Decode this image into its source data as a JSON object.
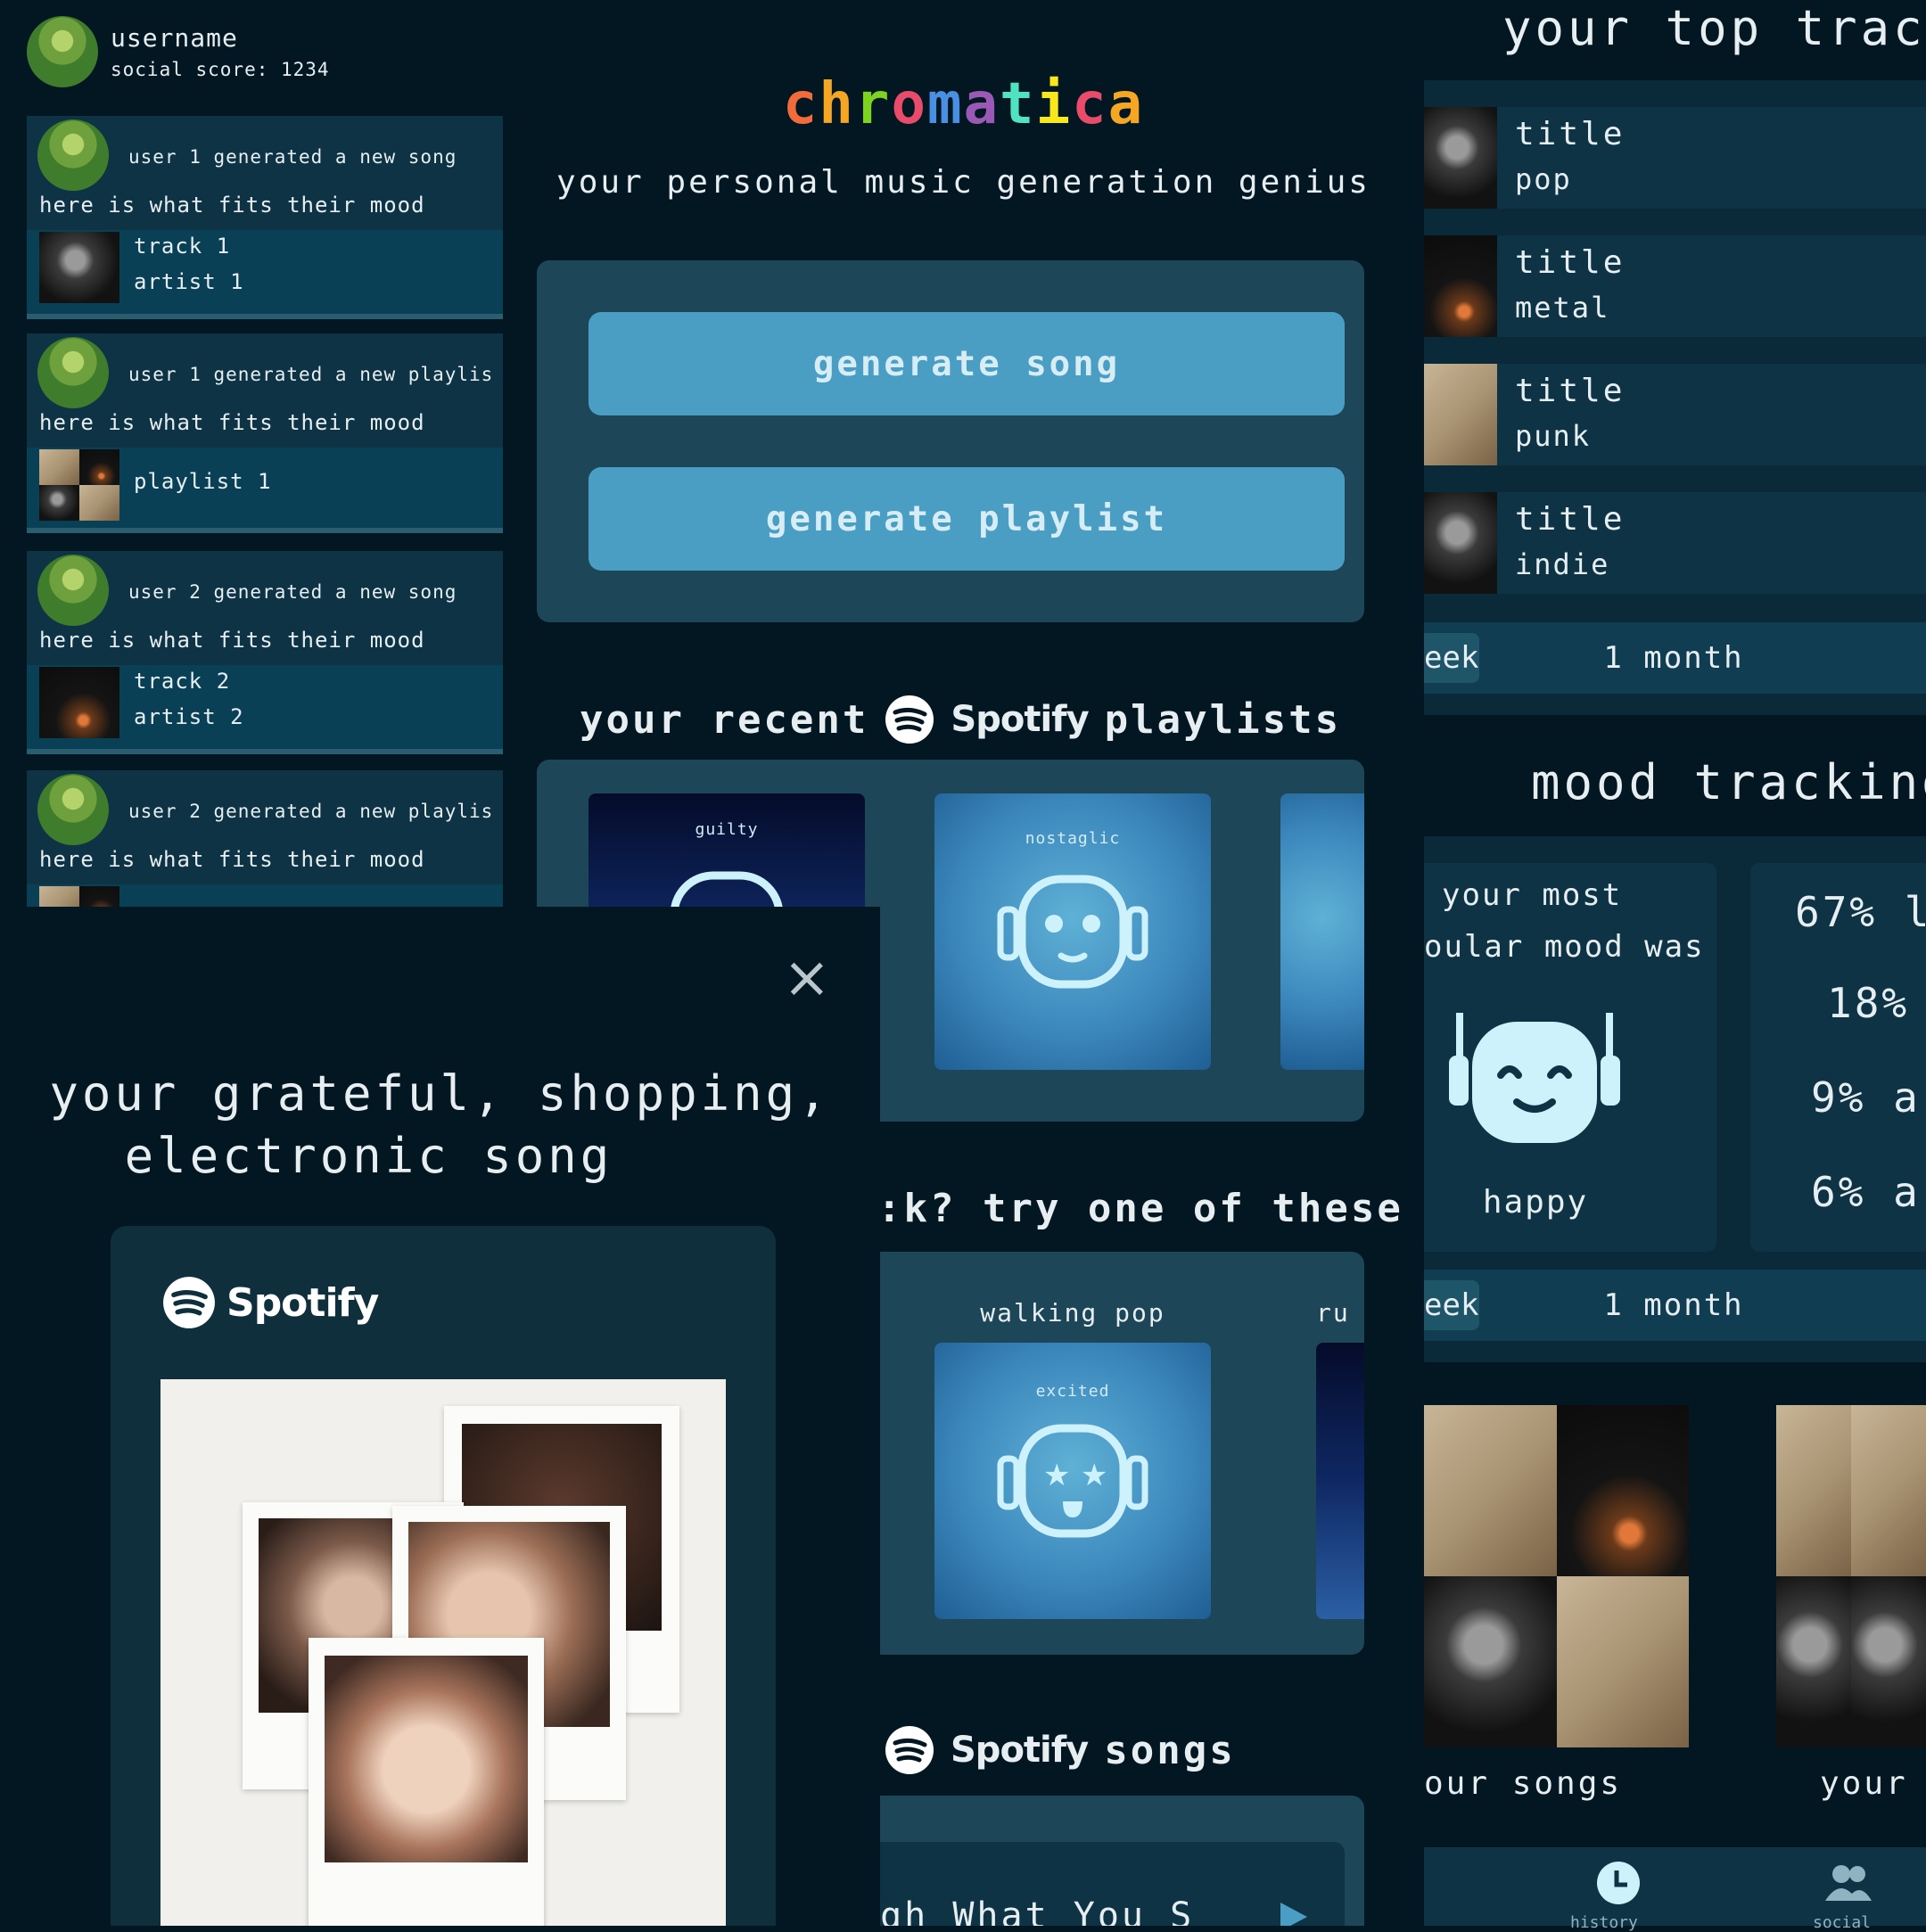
{
  "profile": {
    "username": "username",
    "social_score": "social score: 1234"
  },
  "feed": [
    {
      "headline": "user 1 generated a new song",
      "subline": "here is what fits their mood",
      "line1": "track 1",
      "line2": "artist 1"
    },
    {
      "headline": "user 1 generated a new playlis",
      "subline": "here is what fits their mood",
      "line1": "playlist 1",
      "line2": ""
    },
    {
      "headline": "user 2 generated a new song",
      "subline": "here is what fits their mood",
      "line1": "track 2",
      "line2": "artist 2"
    },
    {
      "headline": "user 2 generated a new playlis",
      "subline": "here is what fits their mood",
      "line1": "",
      "line2": ""
    }
  ],
  "home": {
    "logo": "chromatica",
    "tagline": "your personal music generation genius",
    "generate_song": "generate song",
    "generate_playlist": "generate playlist",
    "recent_prefix": "your recent",
    "recent_suffix": "playlists",
    "spotify_word": "Spotify",
    "recent_tiles": [
      "guilty",
      "nostaglic",
      ""
    ],
    "try_heading": ":k? try one of these",
    "try_labels": [
      "walking pop",
      "ru"
    ],
    "try_tiles": [
      "excited",
      ""
    ],
    "songs_suffix": "songs",
    "partial_song": "igh What You S"
  },
  "stats": {
    "top_tracks_title": "your top track",
    "top_tracks": [
      {
        "title": "title",
        "genre": "pop"
      },
      {
        "title": "title",
        "genre": "metal"
      },
      {
        "title": "title",
        "genre": "punk"
      },
      {
        "title": "title",
        "genre": "indie"
      }
    ],
    "range_week": "eek",
    "range_month": "1 month",
    "mood_title": "mood tracking",
    "popular_line1": "your most",
    "popular_line2": "oular mood was",
    "popular_mood": "happy",
    "mood_percents": [
      "67% l",
      "18%",
      "9% a",
      "6% a"
    ],
    "range_week_2": "eek",
    "range_month_2": "1 month",
    "songs_captions": [
      "our songs",
      "your"
    ],
    "nav": [
      "history",
      "social"
    ]
  },
  "modal": {
    "close": "×",
    "title_line1": "your grateful, shopping,",
    "title_line2": "electronic song",
    "spotify_word": "Spotify"
  },
  "colors": {
    "background": "#031722",
    "panel": "#0d3344",
    "button": "#4a9ec4",
    "logo_letters": [
      "#f26b3a",
      "#f5a623",
      "#7ed321",
      "#e94b6b",
      "#4a90e2",
      "#9b59b6",
      "#50e3c2",
      "#f8e71c",
      "#e94b6b",
      "#f5a623"
    ]
  }
}
